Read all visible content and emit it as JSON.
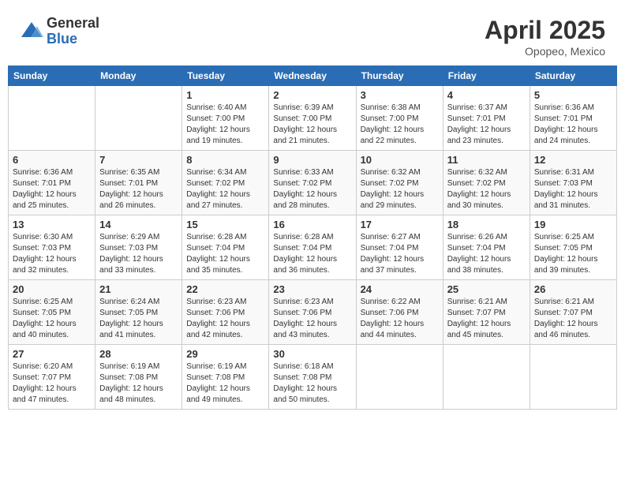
{
  "logo": {
    "general": "General",
    "blue": "Blue"
  },
  "header": {
    "month": "April 2025",
    "location": "Opopeo, Mexico"
  },
  "weekdays": [
    "Sunday",
    "Monday",
    "Tuesday",
    "Wednesday",
    "Thursday",
    "Friday",
    "Saturday"
  ],
  "weeks": [
    [
      {
        "day": "",
        "info": ""
      },
      {
        "day": "",
        "info": ""
      },
      {
        "day": "1",
        "info": "Sunrise: 6:40 AM\nSunset: 7:00 PM\nDaylight: 12 hours and 19 minutes."
      },
      {
        "day": "2",
        "info": "Sunrise: 6:39 AM\nSunset: 7:00 PM\nDaylight: 12 hours and 21 minutes."
      },
      {
        "day": "3",
        "info": "Sunrise: 6:38 AM\nSunset: 7:00 PM\nDaylight: 12 hours and 22 minutes."
      },
      {
        "day": "4",
        "info": "Sunrise: 6:37 AM\nSunset: 7:01 PM\nDaylight: 12 hours and 23 minutes."
      },
      {
        "day": "5",
        "info": "Sunrise: 6:36 AM\nSunset: 7:01 PM\nDaylight: 12 hours and 24 minutes."
      }
    ],
    [
      {
        "day": "6",
        "info": "Sunrise: 6:36 AM\nSunset: 7:01 PM\nDaylight: 12 hours and 25 minutes."
      },
      {
        "day": "7",
        "info": "Sunrise: 6:35 AM\nSunset: 7:01 PM\nDaylight: 12 hours and 26 minutes."
      },
      {
        "day": "8",
        "info": "Sunrise: 6:34 AM\nSunset: 7:02 PM\nDaylight: 12 hours and 27 minutes."
      },
      {
        "day": "9",
        "info": "Sunrise: 6:33 AM\nSunset: 7:02 PM\nDaylight: 12 hours and 28 minutes."
      },
      {
        "day": "10",
        "info": "Sunrise: 6:32 AM\nSunset: 7:02 PM\nDaylight: 12 hours and 29 minutes."
      },
      {
        "day": "11",
        "info": "Sunrise: 6:32 AM\nSunset: 7:02 PM\nDaylight: 12 hours and 30 minutes."
      },
      {
        "day": "12",
        "info": "Sunrise: 6:31 AM\nSunset: 7:03 PM\nDaylight: 12 hours and 31 minutes."
      }
    ],
    [
      {
        "day": "13",
        "info": "Sunrise: 6:30 AM\nSunset: 7:03 PM\nDaylight: 12 hours and 32 minutes."
      },
      {
        "day": "14",
        "info": "Sunrise: 6:29 AM\nSunset: 7:03 PM\nDaylight: 12 hours and 33 minutes."
      },
      {
        "day": "15",
        "info": "Sunrise: 6:28 AM\nSunset: 7:04 PM\nDaylight: 12 hours and 35 minutes."
      },
      {
        "day": "16",
        "info": "Sunrise: 6:28 AM\nSunset: 7:04 PM\nDaylight: 12 hours and 36 minutes."
      },
      {
        "day": "17",
        "info": "Sunrise: 6:27 AM\nSunset: 7:04 PM\nDaylight: 12 hours and 37 minutes."
      },
      {
        "day": "18",
        "info": "Sunrise: 6:26 AM\nSunset: 7:04 PM\nDaylight: 12 hours and 38 minutes."
      },
      {
        "day": "19",
        "info": "Sunrise: 6:25 AM\nSunset: 7:05 PM\nDaylight: 12 hours and 39 minutes."
      }
    ],
    [
      {
        "day": "20",
        "info": "Sunrise: 6:25 AM\nSunset: 7:05 PM\nDaylight: 12 hours and 40 minutes."
      },
      {
        "day": "21",
        "info": "Sunrise: 6:24 AM\nSunset: 7:05 PM\nDaylight: 12 hours and 41 minutes."
      },
      {
        "day": "22",
        "info": "Sunrise: 6:23 AM\nSunset: 7:06 PM\nDaylight: 12 hours and 42 minutes."
      },
      {
        "day": "23",
        "info": "Sunrise: 6:23 AM\nSunset: 7:06 PM\nDaylight: 12 hours and 43 minutes."
      },
      {
        "day": "24",
        "info": "Sunrise: 6:22 AM\nSunset: 7:06 PM\nDaylight: 12 hours and 44 minutes."
      },
      {
        "day": "25",
        "info": "Sunrise: 6:21 AM\nSunset: 7:07 PM\nDaylight: 12 hours and 45 minutes."
      },
      {
        "day": "26",
        "info": "Sunrise: 6:21 AM\nSunset: 7:07 PM\nDaylight: 12 hours and 46 minutes."
      }
    ],
    [
      {
        "day": "27",
        "info": "Sunrise: 6:20 AM\nSunset: 7:07 PM\nDaylight: 12 hours and 47 minutes."
      },
      {
        "day": "28",
        "info": "Sunrise: 6:19 AM\nSunset: 7:08 PM\nDaylight: 12 hours and 48 minutes."
      },
      {
        "day": "29",
        "info": "Sunrise: 6:19 AM\nSunset: 7:08 PM\nDaylight: 12 hours and 49 minutes."
      },
      {
        "day": "30",
        "info": "Sunrise: 6:18 AM\nSunset: 7:08 PM\nDaylight: 12 hours and 50 minutes."
      },
      {
        "day": "",
        "info": ""
      },
      {
        "day": "",
        "info": ""
      },
      {
        "day": "",
        "info": ""
      }
    ]
  ]
}
